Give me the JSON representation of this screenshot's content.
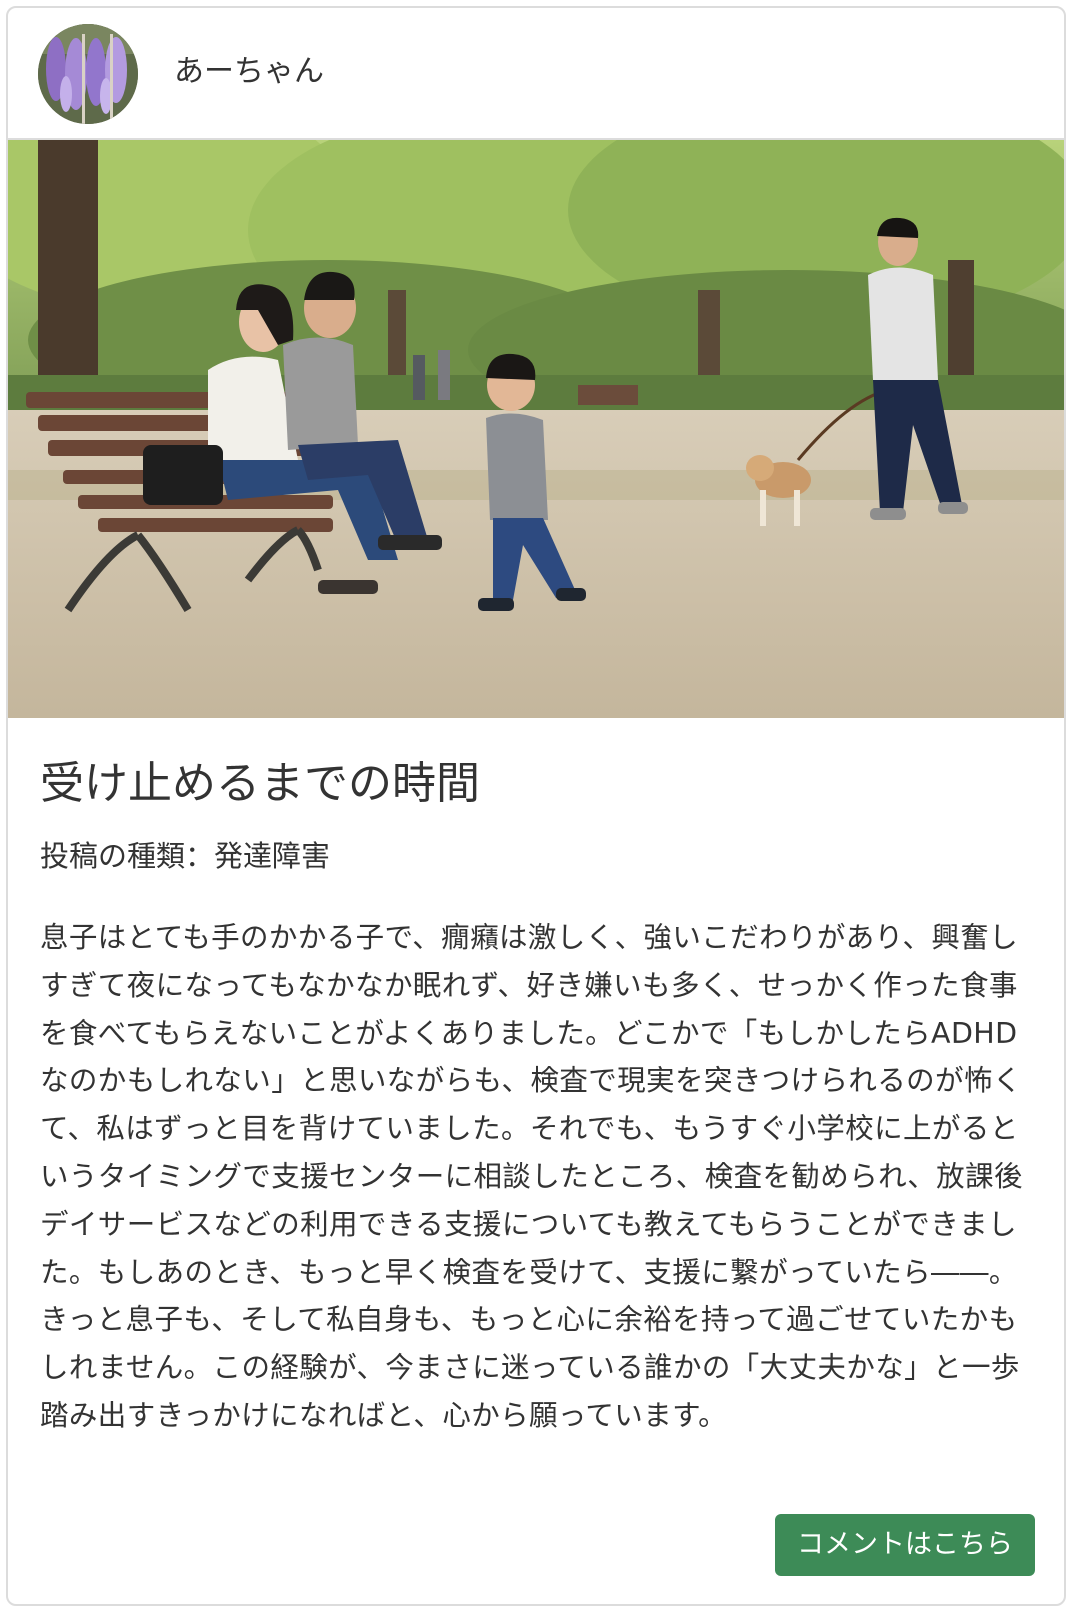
{
  "post": {
    "author": {
      "name": "あーちゃん",
      "avatar_icon": "wisteria-flower-photo"
    },
    "hero_image": {
      "description_icon": "family-in-park-photo"
    },
    "title": "受け止めるまでの時間",
    "type_line": "投稿の種類：発達障害",
    "body": "息子はとても手のかかる子で、癇癪は激しく、強いこだわりがあり、興奮しすぎて夜になってもなかなか眠れず、好き嫌いも多く、せっかく作った食事を食べてもらえないことがよくありました。どこかで「もしかしたらADHDなのかもしれない」と思いながらも、検査で現実を突きつけられるのが怖くて、私はずっと目を背けていました。それでも、もうすぐ小学校に上がるというタイミングで支援センターに相談したところ、検査を勧められ、放課後デイサービスなどの利用できる支援についても教えてもらうことができました。もしあのとき、もっと早く検査を受けて、支援に繋がっていたら――。きっと息子も、そして私自身も、もっと心に余裕を持って過ごせていたかもしれません。この経験が、今まさに迷っている誰かの「大丈夫かな」と一歩踏み出すきっかけになればと、心から願っています。",
    "comment_button_label": "コメントはこちら"
  },
  "colors": {
    "button_bg": "#3d8b57",
    "border": "#dcdcdc",
    "text": "#333333"
  }
}
